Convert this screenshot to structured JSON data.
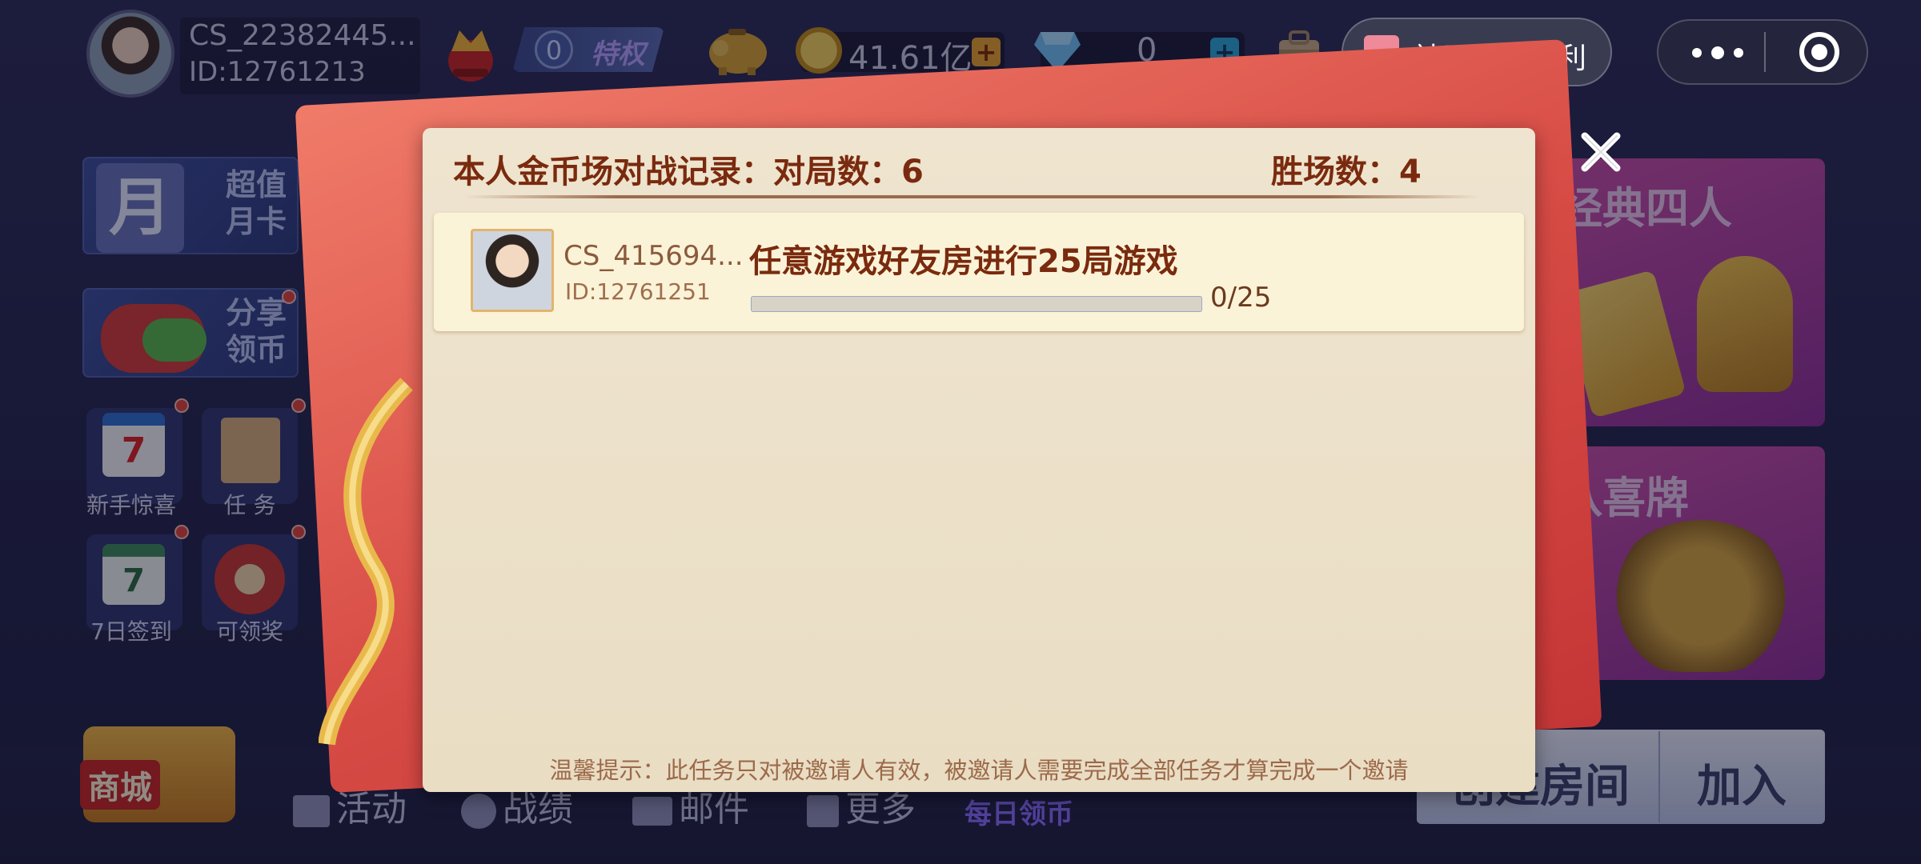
{
  "topbar": {
    "username": "CS_22382445...",
    "user_id": "ID:12761213",
    "vip_level": "0",
    "vip_label": "特权",
    "coins": "41.61亿",
    "diamonds": "0",
    "community_button": "社区任务福利"
  },
  "left_menu": {
    "monthly_card": "超值\n月卡",
    "monthly_card_glyph": "月",
    "share": "分享\n领币",
    "newbie": "新手惊喜",
    "tasks": "任 务",
    "signin": "7日签到",
    "signin_day": "7",
    "claimable": "可领奖"
  },
  "right_cards": {
    "classic_four": "经典四人",
    "baxi": "八喜牌"
  },
  "bottom": {
    "shop": "商城",
    "activity": "活动",
    "record": "战绩",
    "mail": "邮件",
    "more": "更多",
    "daily_coins": "每日领币",
    "create_room": "创建房间",
    "join": "加入"
  },
  "modal": {
    "header": "本人金币场对战记录：对局数：6",
    "wins": "胜场数：4",
    "task": {
      "name": "CS_415694...",
      "id": "ID:12761251",
      "title": "任意游戏好友房进行25局游戏",
      "progress_text": "0/25",
      "progress_fraction": 0
    },
    "tip": "温馨提示：此任务只对被邀请人有效，被邀请人需要完成全部任务才算完成一个邀请"
  },
  "colors": {
    "accent_red": "#d64a44",
    "panel_bg": "#efe4cf",
    "header_text": "#7a2a0e",
    "progress_fill": "#7e9bd3"
  },
  "icons": [
    "crown-icon",
    "vip-shield-icon",
    "piggy-bank-icon",
    "gold-coin-icon",
    "diamond-icon",
    "bag-icon",
    "gift-icon",
    "more-dots-icon",
    "target-circle-icon",
    "close-icon"
  ]
}
